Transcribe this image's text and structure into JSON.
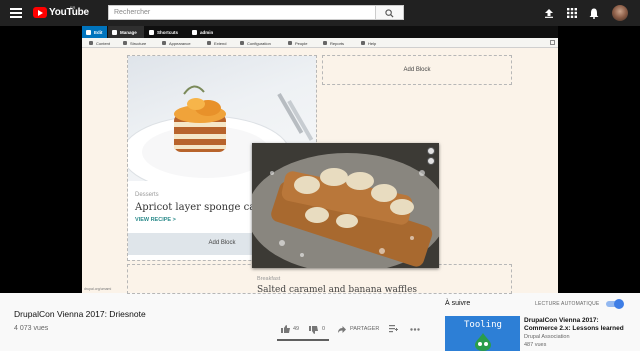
{
  "youtube": {
    "logo_text": "YouTube",
    "country_code": "FR",
    "search_placeholder": "Rechercher"
  },
  "drupal": {
    "toolbar": {
      "edit": "Edit",
      "manage": "Manage",
      "shortcuts": "Shortcuts",
      "admin": "admin"
    },
    "tray": [
      "Content",
      "Structure",
      "Appearance",
      "Extend",
      "Configuration",
      "People",
      "Reports",
      "Help"
    ],
    "add_block_label": "Add Block",
    "card": {
      "tag": "Desserts",
      "title": "Apricot layer sponge cake",
      "link": "VIEW RECIPE >"
    },
    "second_card": {
      "tag": "Breakfast",
      "title": "Salted caramel and banana waffles"
    },
    "watermark": "drupal.org/umami"
  },
  "video": {
    "title": "DrupalCon Vienna 2017: Driesnote",
    "views": "4 073 vues",
    "likes": "49",
    "dislikes": "0",
    "share": "PARTAGER"
  },
  "sidebar": {
    "up_next": "À suivre",
    "autoplay": "LECTURE AUTOMATIQUE",
    "autoplay_on": true,
    "recommendation": {
      "thumb_text": "Tooling",
      "title": "DrupalCon Vienna 2017: Commerce 2.x: Lessons learned",
      "channel": "Drupal Association",
      "views": "487 vues"
    }
  },
  "colors": {
    "youtube_red": "#ff0000",
    "topbar": "#212121",
    "drupal_blue": "#0074bd",
    "drupal_toolbar": "#0f0f0f",
    "autoplay_blue": "#3e7ee6"
  }
}
